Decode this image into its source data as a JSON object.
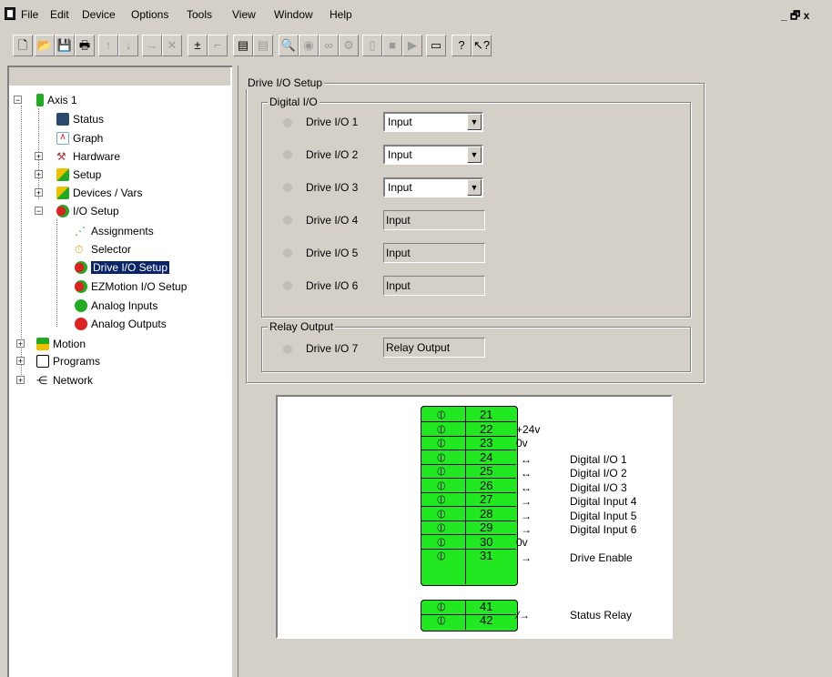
{
  "menu": [
    "File",
    "Edit",
    "Device",
    "Options",
    "Tools",
    "View",
    "Window",
    "Help"
  ],
  "window_buttons": "_ 🗗 x",
  "tree": {
    "root": "Axis 1",
    "items": [
      {
        "label": "Status"
      },
      {
        "label": "Graph"
      },
      {
        "label": "Hardware"
      },
      {
        "label": "Setup"
      },
      {
        "label": "Devices / Vars"
      },
      {
        "label": "I/O Setup"
      },
      {
        "label": "Assignments"
      },
      {
        "label": "Selector"
      },
      {
        "label": "Drive I/O Setup"
      },
      {
        "label": "EZMotion I/O Setup"
      },
      {
        "label": "Analog Inputs"
      },
      {
        "label": "Analog Outputs"
      },
      {
        "label": "Motion"
      },
      {
        "label": "Programs"
      },
      {
        "label": "Network"
      }
    ]
  },
  "panel": {
    "title": "Drive I/O Setup",
    "digital_group": "Digital I/O",
    "relay_group": "Relay Output",
    "io": [
      {
        "label": "Drive I/O 1",
        "value": "Input"
      },
      {
        "label": "Drive I/O 2",
        "value": "Input"
      },
      {
        "label": "Drive I/O 3",
        "value": "Input"
      },
      {
        "label": "Drive I/O 4",
        "value": "Input"
      },
      {
        "label": "Drive I/O 5",
        "value": "Input"
      },
      {
        "label": "Drive I/O 6",
        "value": "Input"
      }
    ],
    "relay": {
      "label": "Drive I/O 7",
      "value": "Relay Output"
    }
  },
  "diagram": {
    "terminals": [
      "21",
      "22",
      "23",
      "24",
      "25",
      "26",
      "27",
      "28",
      "29",
      "30",
      "31"
    ],
    "relay_terminals": [
      "41",
      "42"
    ],
    "notes": {
      "22": "+24v",
      "23": "0v",
      "30": "0v"
    },
    "signals": [
      {
        "term": "24",
        "label": "Digital I/O 1",
        "dir": "↔"
      },
      {
        "term": "25",
        "label": "Digital I/O 2",
        "dir": "↔"
      },
      {
        "term": "26",
        "label": "Digital I/O 3",
        "dir": "↔"
      },
      {
        "term": "27",
        "label": "Digital Input 4",
        "dir": "→"
      },
      {
        "term": "28",
        "label": "Digital Input 5",
        "dir": "→"
      },
      {
        "term": "29",
        "label": "Digital Input 6",
        "dir": "→"
      },
      {
        "term": "31",
        "label": "Drive Enable",
        "dir": "→"
      }
    ],
    "relay_label": "Status Relay"
  }
}
